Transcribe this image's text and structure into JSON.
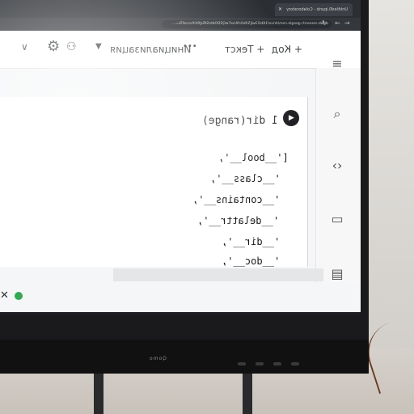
{
  "browser": {
    "tab_title": "Untitled0.ipynb - Colaboratory",
    "url": "colab.research.google.com/drive/1KbO3wiJ5XbXr0UxrFwQ5DOdtoSf6zJ9X#scrollTo=..."
  },
  "toolbar": {
    "add_code": "+ Код",
    "add_text": "+ Текст",
    "more": "•••",
    "init_status": "Инициализация"
  },
  "cell": {
    "run_icon": "play-icon",
    "code": "1 dir(range)"
  },
  "output": {
    "lines": [
      "['__bool__',",
      "'__class__',",
      "'__contains__',",
      "'__delattr__',",
      "'__dir__',",
      "'__doc__',"
    ]
  },
  "monitor": {
    "brand": "Qomo"
  },
  "colors": {
    "run_button": "#202124",
    "status_ok": "#34a853",
    "taskbar": "#1c1d22"
  }
}
